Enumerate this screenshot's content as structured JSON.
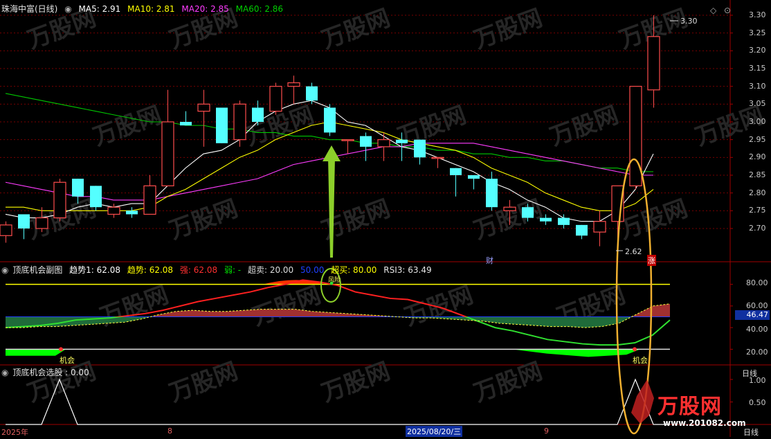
{
  "main_header": {
    "title": "珠海中富(日线)",
    "ma5_label": "MA5: 2.91",
    "ma10_label": "MA10: 2.81",
    "ma20_label": "MA20: 2.85",
    "ma60_label": "MA60: 2.86"
  },
  "sub1_header": {
    "title": "顶底机会副图",
    "trend1": "趋势1: 62.08",
    "trend": "趋势: 62.08",
    "strong": "强: 62.08",
    "weak": "弱: -",
    "oversold": "超卖: 20.00",
    "mid": "50.00",
    "overbought": "超买: 80.00",
    "rsi3": "RSI3: 63.49"
  },
  "sub2_header": {
    "title": "顶底机会选股 : 0.00"
  },
  "price_axis": [
    "3.30",
    "3.25",
    "3.20",
    "3.15",
    "3.10",
    "3.05",
    "3.00",
    "2.95",
    "2.90",
    "2.85",
    "2.80",
    "2.75",
    "2.70"
  ],
  "osc_axis": [
    "80.00",
    "60.00",
    "40.00",
    "20.00"
  ],
  "osc_current": "46.47",
  "sel_axis": [
    "1.00",
    "0.50"
  ],
  "annotations": {
    "high_label": "3.30",
    "low_label": "2.62",
    "cai": "财",
    "zhang": "涨",
    "chance_left": "机会",
    "chance_right": "机会",
    "risk": "风险"
  },
  "date_axis": {
    "d1": "2025年",
    "d2": "8",
    "d3": "2025/08/20/三",
    "d4": "9",
    "period": "日线"
  },
  "watermark": "万股网",
  "watermark_sub": "www.201082.com",
  "colors": {
    "up": "#ff4d4d",
    "down": "#54ffff",
    "ma5": "#ffffff",
    "ma10": "#ffff00",
    "ma20": "#ff3cff",
    "ma60": "#00c800",
    "grid": "#7a0000"
  },
  "chart_data": {
    "type": "candlestick",
    "y_range": [
      2.62,
      3.32
    ],
    "candles": [
      {
        "o": 2.68,
        "h": 2.72,
        "l": 2.66,
        "c": 2.71
      },
      {
        "o": 2.74,
        "h": 2.74,
        "l": 2.67,
        "c": 2.7
      },
      {
        "o": 2.7,
        "h": 2.76,
        "l": 2.69,
        "c": 2.73
      },
      {
        "o": 2.73,
        "h": 2.84,
        "l": 2.72,
        "c": 2.83
      },
      {
        "o": 2.84,
        "h": 2.84,
        "l": 2.77,
        "c": 2.79
      },
      {
        "o": 2.82,
        "h": 2.82,
        "l": 2.75,
        "c": 2.76
      },
      {
        "o": 2.74,
        "h": 2.77,
        "l": 2.73,
        "c": 2.76
      },
      {
        "o": 2.75,
        "h": 2.76,
        "l": 2.73,
        "c": 2.74
      },
      {
        "o": 2.74,
        "h": 2.85,
        "l": 2.74,
        "c": 2.82
      },
      {
        "o": 2.82,
        "h": 3.09,
        "l": 2.82,
        "c": 3.0
      },
      {
        "o": 3.0,
        "h": 3.03,
        "l": 2.99,
        "c": 2.99
      },
      {
        "o": 3.03,
        "h": 3.09,
        "l": 2.93,
        "c": 3.05
      },
      {
        "o": 3.04,
        "h": 3.04,
        "l": 2.94,
        "c": 2.94
      },
      {
        "o": 2.95,
        "h": 3.06,
        "l": 2.93,
        "c": 3.05
      },
      {
        "o": 3.04,
        "h": 3.06,
        "l": 2.99,
        "c": 3.0
      },
      {
        "o": 3.03,
        "h": 3.11,
        "l": 3.02,
        "c": 3.1
      },
      {
        "o": 3.1,
        "h": 3.13,
        "l": 3.05,
        "c": 3.11
      },
      {
        "o": 3.1,
        "h": 3.11,
        "l": 3.05,
        "c": 3.06
      },
      {
        "o": 3.04,
        "h": 3.05,
        "l": 2.96,
        "c": 2.97
      },
      {
        "o": 2.95,
        "h": 2.95,
        "l": 2.91,
        "c": 2.95
      },
      {
        "o": 2.96,
        "h": 2.97,
        "l": 2.89,
        "c": 2.93
      },
      {
        "o": 2.93,
        "h": 2.97,
        "l": 2.89,
        "c": 2.95
      },
      {
        "o": 2.95,
        "h": 2.97,
        "l": 2.89,
        "c": 2.94
      },
      {
        "o": 2.95,
        "h": 2.95,
        "l": 2.88,
        "c": 2.9
      },
      {
        "o": 2.9,
        "h": 2.9,
        "l": 2.87,
        "c": 2.9
      },
      {
        "o": 2.87,
        "h": 2.87,
        "l": 2.79,
        "c": 2.85
      },
      {
        "o": 2.85,
        "h": 2.85,
        "l": 2.81,
        "c": 2.84
      },
      {
        "o": 2.84,
        "h": 2.86,
        "l": 2.75,
        "c": 2.76
      },
      {
        "o": 2.75,
        "h": 2.78,
        "l": 2.71,
        "c": 2.76
      },
      {
        "o": 2.76,
        "h": 2.77,
        "l": 2.72,
        "c": 2.73
      },
      {
        "o": 2.73,
        "h": 2.74,
        "l": 2.71,
        "c": 2.72
      },
      {
        "o": 2.73,
        "h": 2.74,
        "l": 2.7,
        "c": 2.71
      },
      {
        "o": 2.71,
        "h": 2.71,
        "l": 2.67,
        "c": 2.68
      },
      {
        "o": 2.69,
        "h": 2.75,
        "l": 2.65,
        "c": 2.72
      },
      {
        "o": 2.72,
        "h": 2.82,
        "l": 2.62,
        "c": 2.82
      },
      {
        "o": 2.82,
        "h": 3.1,
        "l": 2.81,
        "c": 3.1
      },
      {
        "o": 3.09,
        "h": 3.3,
        "l": 3.04,
        "c": 3.24
      }
    ],
    "ma5": [
      2.74,
      2.73,
      2.73,
      2.74,
      2.76,
      2.77,
      2.76,
      2.77,
      2.77,
      2.82,
      2.87,
      2.91,
      2.92,
      2.95,
      3.0,
      3.03,
      3.05,
      3.06,
      3.04,
      3.0,
      2.99,
      2.96,
      2.93,
      2.92,
      2.9,
      2.88,
      2.86,
      2.83,
      2.81,
      2.78,
      2.76,
      2.73,
      2.72,
      2.72,
      2.75,
      2.81,
      2.91
    ],
    "ma10": [
      2.76,
      2.76,
      2.75,
      2.75,
      2.75,
      2.75,
      2.75,
      2.75,
      2.76,
      2.79,
      2.81,
      2.84,
      2.87,
      2.9,
      2.92,
      2.95,
      2.97,
      2.99,
      3.0,
      2.99,
      2.98,
      2.97,
      2.95,
      2.94,
      2.93,
      2.92,
      2.9,
      2.87,
      2.85,
      2.83,
      2.8,
      2.78,
      2.76,
      2.75,
      2.75,
      2.77,
      2.81
    ],
    "ma20": [
      2.83,
      2.82,
      2.81,
      2.8,
      2.79,
      2.79,
      2.78,
      2.78,
      2.78,
      2.79,
      2.8,
      2.81,
      2.82,
      2.83,
      2.84,
      2.86,
      2.88,
      2.89,
      2.9,
      2.91,
      2.92,
      2.93,
      2.93,
      2.94,
      2.94,
      2.94,
      2.94,
      2.93,
      2.92,
      2.91,
      2.9,
      2.89,
      2.88,
      2.87,
      2.86,
      2.85,
      2.85
    ],
    "ma60": [
      3.08,
      3.07,
      3.06,
      3.05,
      3.04,
      3.03,
      3.02,
      3.01,
      3.0,
      3.0,
      2.99,
      2.99,
      2.98,
      2.98,
      2.97,
      2.97,
      2.96,
      2.96,
      2.95,
      2.95,
      2.94,
      2.94,
      2.93,
      2.93,
      2.92,
      2.92,
      2.91,
      2.91,
      2.9,
      2.9,
      2.89,
      2.89,
      2.88,
      2.87,
      2.87,
      2.86,
      2.86
    ],
    "osc_range": [
      10,
      90
    ],
    "trend_line": [
      40,
      41,
      42,
      44,
      47,
      48,
      49,
      51,
      53,
      56,
      60,
      64,
      67,
      70,
      73,
      77,
      80,
      84,
      82,
      79,
      73,
      70,
      67,
      66,
      62,
      58,
      52,
      46,
      40,
      37,
      33,
      29,
      27,
      25,
      24,
      24,
      26,
      33,
      47
    ],
    "osc_area": [
      40,
      40,
      41,
      41,
      42,
      43,
      44,
      45,
      48,
      52,
      55,
      56,
      55,
      55,
      56,
      57,
      57,
      57,
      55,
      54,
      53,
      52,
      51,
      50,
      49,
      49,
      48,
      47,
      46,
      44,
      43,
      42,
      41,
      41,
      40,
      41,
      44,
      52,
      60,
      62
    ],
    "select_signal": [
      0,
      0,
      0,
      1,
      0,
      0,
      0,
      0,
      0,
      0,
      0,
      0,
      0,
      0,
      0,
      0,
      0,
      0,
      0,
      0,
      0,
      0,
      0,
      0,
      0,
      0,
      0,
      0,
      0,
      0,
      0,
      0,
      0,
      0,
      0,
      1,
      0,
      0
    ]
  }
}
